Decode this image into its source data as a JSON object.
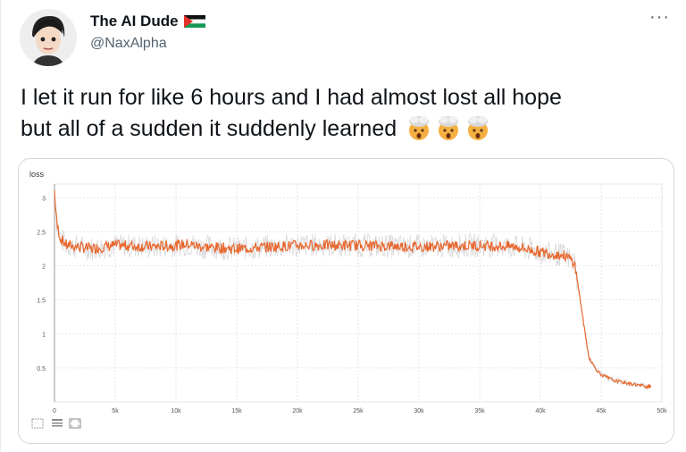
{
  "author": {
    "display_name": "The AI Dude",
    "handle": "@NaxAlpha",
    "flag_icon": "palestine-flag-icon",
    "avatar_icon": "cartoon-avatar-icon"
  },
  "more_icon": "more-horizontal-icon",
  "tweet": {
    "line1": "I let it run for like 6 hours and I had almost lost all hope",
    "line2": "but all of a sudden it suddenly learned",
    "emoji": [
      "exploding-head-icon",
      "exploding-head-icon",
      "exploding-head-icon"
    ]
  },
  "colors": {
    "series": "#e8672e",
    "raw_series": "#d9d9d9",
    "grid": "#e6e6e6",
    "vertical_marker": "#999999"
  },
  "chart_data": {
    "type": "line",
    "title": "loss",
    "xlabel": "",
    "ylabel": "",
    "xlim": [
      0,
      50000
    ],
    "ylim": [
      0,
      3.2
    ],
    "x_ticks": [
      "0",
      "5k",
      "10k",
      "15k",
      "20k",
      "25k",
      "30k",
      "35k",
      "40k",
      "45k",
      "50k"
    ],
    "y_ticks": [
      "0.5",
      "1",
      "1.5",
      "2",
      "2.5",
      "3"
    ],
    "grid": true,
    "series": [
      {
        "x": [
          0,
          200,
          500,
          1000,
          2000,
          3000,
          5000,
          8000,
          10000,
          11000,
          12000,
          15000,
          20000,
          25000,
          30000,
          35000,
          38000,
          40000,
          42000,
          42800,
          43200,
          43600,
          44000,
          44500,
          45000,
          46000,
          47000,
          48000,
          49000
        ],
        "y": [
          3.1,
          2.6,
          2.4,
          2.3,
          2.28,
          2.25,
          2.3,
          2.28,
          2.3,
          2.32,
          2.28,
          2.25,
          2.3,
          2.3,
          2.28,
          2.3,
          2.28,
          2.2,
          2.15,
          2.05,
          1.6,
          1.1,
          0.65,
          0.5,
          0.4,
          0.32,
          0.28,
          0.25,
          0.22
        ]
      }
    ]
  },
  "toolbar": [
    "expand-icon",
    "data-table-icon",
    "fit-domain-icon"
  ]
}
